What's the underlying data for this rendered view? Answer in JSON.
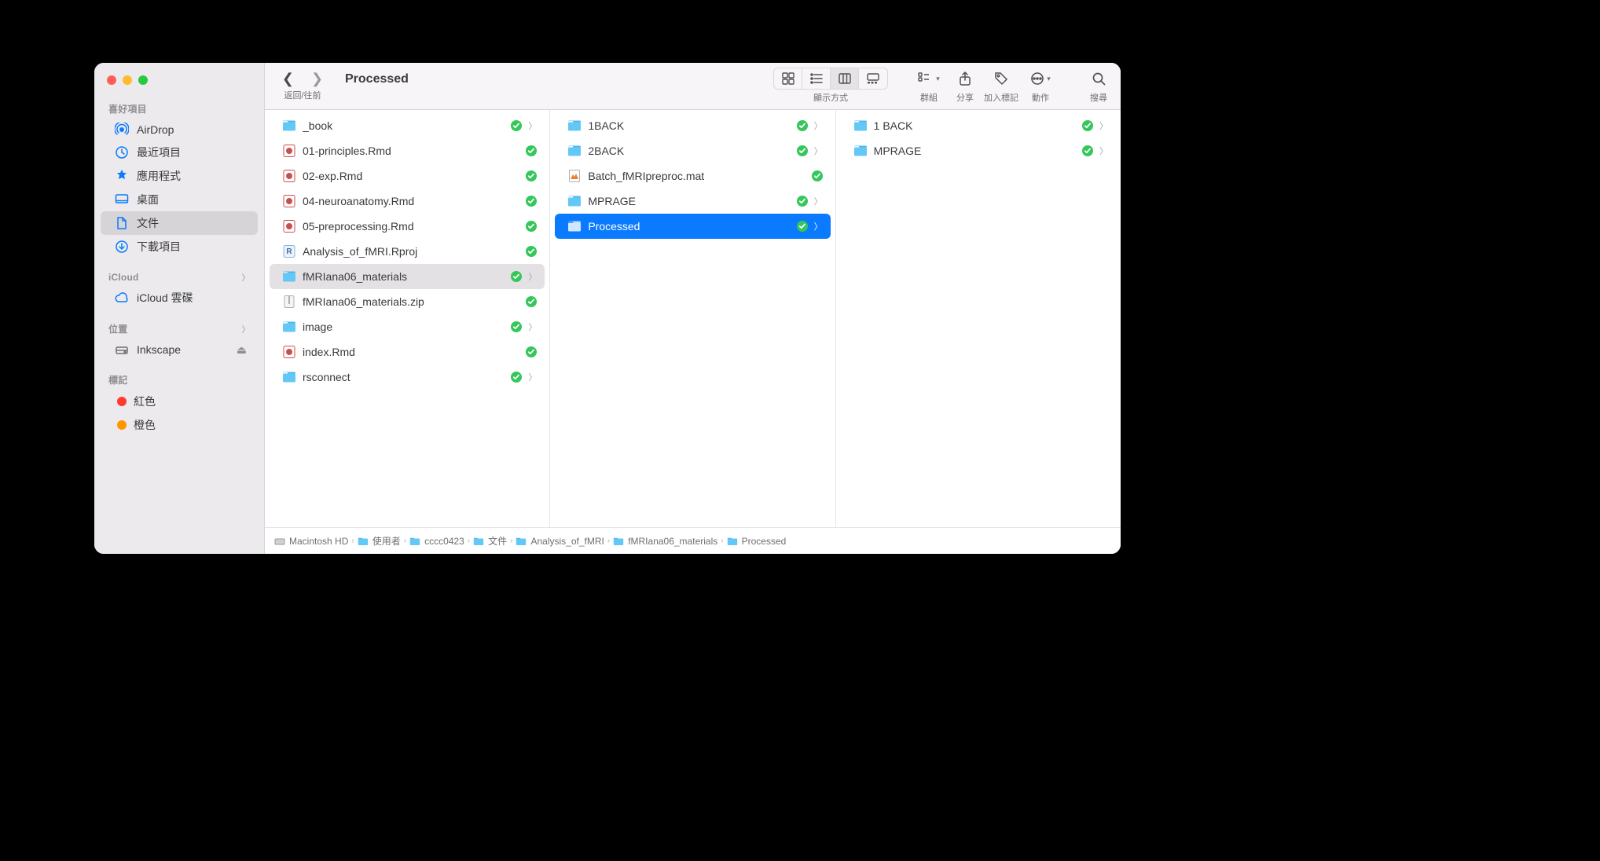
{
  "window": {
    "title": "Processed"
  },
  "toolbar": {
    "nav_label": "返回/往前",
    "view_label": "顯示方式",
    "group_label": "群組",
    "share_label": "分享",
    "tag_label": "加入標記",
    "action_label": "動作",
    "search_label": "搜尋"
  },
  "sidebar": {
    "favorites": {
      "header": "喜好項目",
      "items": [
        {
          "icon": "airdrop",
          "label": "AirDrop"
        },
        {
          "icon": "recent",
          "label": "最近項目"
        },
        {
          "icon": "apps",
          "label": "應用程式"
        },
        {
          "icon": "desktop",
          "label": "桌面"
        },
        {
          "icon": "documents",
          "label": "文件",
          "active": true
        },
        {
          "icon": "downloads",
          "label": "下載項目"
        }
      ]
    },
    "icloud": {
      "header": "iCloud",
      "items": [
        {
          "icon": "cloud",
          "label": "iCloud 雲碟"
        }
      ]
    },
    "locations": {
      "header": "位置",
      "items": [
        {
          "icon": "disk",
          "label": "Inkscape",
          "eject": true
        }
      ]
    },
    "tags": {
      "header": "標記",
      "items": [
        {
          "color": "#ff3b30",
          "label": "紅色"
        },
        {
          "color": "#ff9500",
          "label": "橙色"
        }
      ]
    }
  },
  "columns": [
    [
      {
        "type": "folder",
        "name": "_book",
        "synced": true,
        "chevron": true
      },
      {
        "type": "rmd",
        "name": "01-principles.Rmd",
        "synced": true
      },
      {
        "type": "rmd",
        "name": "02-exp.Rmd",
        "synced": true
      },
      {
        "type": "rmd",
        "name": "04-neuroanatomy.Rmd",
        "synced": true
      },
      {
        "type": "rmd",
        "name": "05-preprocessing.Rmd",
        "synced": true
      },
      {
        "type": "rproj",
        "name": "Analysis_of_fMRI.Rproj",
        "synced": true
      },
      {
        "type": "folder",
        "name": "fMRIana06_materials",
        "synced": true,
        "chevron": true,
        "selected": "gray"
      },
      {
        "type": "zip",
        "name": "fMRIana06_materials.zip",
        "synced": true
      },
      {
        "type": "folder",
        "name": "image",
        "synced": true,
        "chevron": true
      },
      {
        "type": "rmd",
        "name": "index.Rmd",
        "synced": true
      },
      {
        "type": "folder",
        "name": "rsconnect",
        "synced": true,
        "chevron": true
      }
    ],
    [
      {
        "type": "folder",
        "name": "1BACK",
        "synced": true,
        "chevron": true
      },
      {
        "type": "folder",
        "name": "2BACK",
        "synced": true,
        "chevron": true
      },
      {
        "type": "mat",
        "name": "Batch_fMRIpreproc.mat",
        "synced": true
      },
      {
        "type": "folder",
        "name": "MPRAGE",
        "synced": true,
        "chevron": true
      },
      {
        "type": "folder",
        "name": "Processed",
        "synced": true,
        "chevron": true,
        "selected": "blue"
      }
    ],
    [
      {
        "type": "folder",
        "name": "1 BACK",
        "synced": true,
        "chevron": true
      },
      {
        "type": "folder",
        "name": "MPRAGE",
        "synced": true,
        "chevron": true
      }
    ]
  ],
  "pathbar": [
    {
      "icon": "hd",
      "label": "Macintosh HD"
    },
    {
      "icon": "folder",
      "label": "使用者"
    },
    {
      "icon": "folder",
      "label": "cccc0423"
    },
    {
      "icon": "folder",
      "label": "文件"
    },
    {
      "icon": "folder",
      "label": "Analysis_of_fMRI"
    },
    {
      "icon": "folder",
      "label": "fMRIana06_materials"
    },
    {
      "icon": "folder",
      "label": "Processed"
    }
  ]
}
